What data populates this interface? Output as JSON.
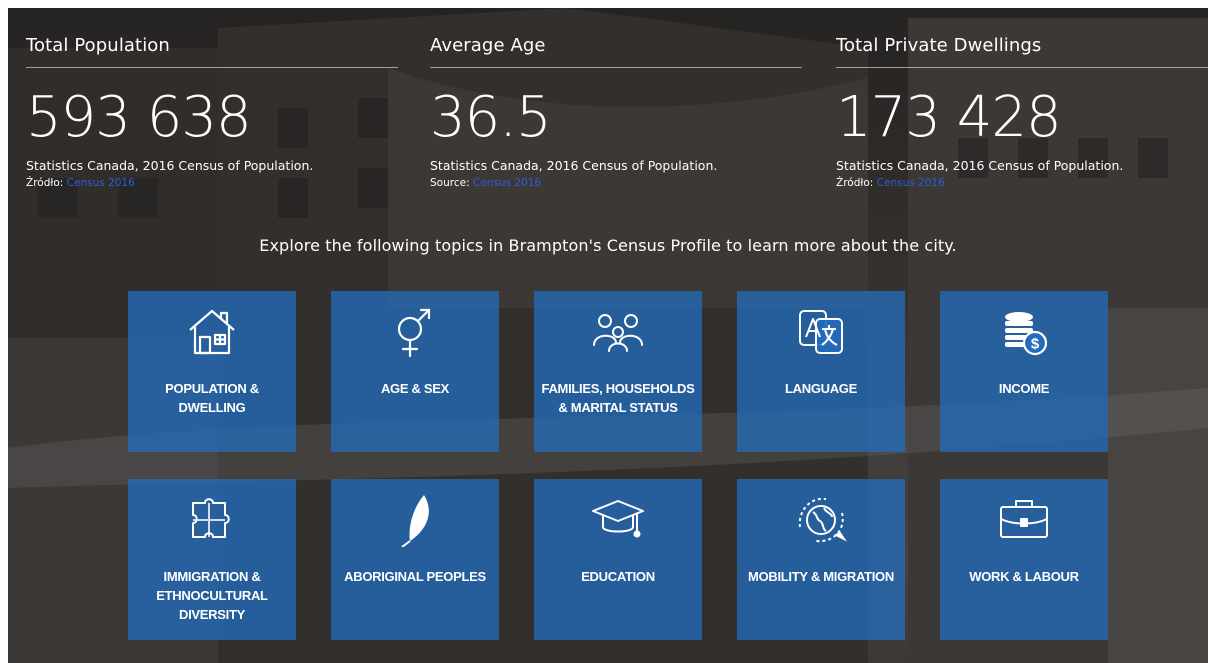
{
  "stats": [
    {
      "title": "Total Population",
      "value": "593 638",
      "source": "Statistics Canada, 2016 Census of Population.",
      "link_prefix": "Źródło:",
      "link_text": "Census 2016"
    },
    {
      "title": "Average Age",
      "value": "36.5",
      "source": "Statistics Canada, 2016 Census of Population.",
      "link_prefix": "Source:",
      "link_text": "Census 2016"
    },
    {
      "title": "Total Private Dwellings",
      "value": "173 428",
      "source": "Statistics Canada, 2016 Census of Population.",
      "link_prefix": "Źródło:",
      "link_text": "Census 2016"
    }
  ],
  "intro": "Explore the following topics in Brampton's Census Profile to learn more about the city.",
  "topics": [
    {
      "label": "POPULATION & DWELLING",
      "icon": "house-icon"
    },
    {
      "label": "AGE & SEX",
      "icon": "gender-symbol-icon"
    },
    {
      "label": "FAMILIES, HOUSEHOLDS & MARITAL STATUS",
      "icon": "family-icon"
    },
    {
      "label": "LANGUAGE",
      "icon": "translate-icon"
    },
    {
      "label": "INCOME",
      "icon": "coins-icon"
    },
    {
      "label": "IMMIGRATION & ETHNOCULTURAL DIVERSITY",
      "icon": "puzzle-icon"
    },
    {
      "label": "ABORIGINAL PEOPLES",
      "icon": "feather-icon"
    },
    {
      "label": "EDUCATION",
      "icon": "graduation-cap-icon"
    },
    {
      "label": "MOBILITY & MIGRATION",
      "icon": "globe-plane-icon"
    },
    {
      "label": "WORK & LABOUR",
      "icon": "briefcase-icon"
    }
  ],
  "colors": {
    "tile": "#226cba",
    "link": "#2d5fd6",
    "text": "#ffffff"
  }
}
